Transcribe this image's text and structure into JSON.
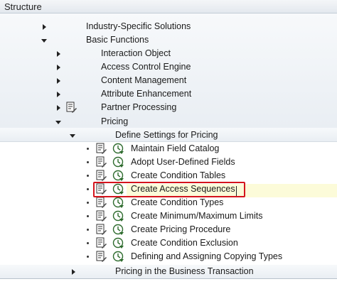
{
  "header": {
    "title": "Structure"
  },
  "tree": {
    "industry_specific": "Industry-Specific Solutions",
    "basic_functions": "Basic Functions",
    "interaction_object": "Interaction Object",
    "access_control_engine": "Access Control Engine",
    "content_management": "Content Management",
    "attribute_enhancement": "Attribute Enhancement",
    "partner_processing": "Partner Processing",
    "pricing": "Pricing",
    "define_settings": "Define Settings for Pricing",
    "activities": [
      "Maintain Field Catalog",
      "Adopt User-Defined Fields",
      "Create Condition Tables",
      "Create Access Sequences",
      "Create Condition Types",
      "Create Minimum/Maximum Limits",
      "Create Pricing Procedure",
      "Create Condition Exclusion",
      "Defining and Assigning Copying Types"
    ],
    "pricing_business_transaction": "Pricing in the Business Transaction"
  },
  "icons": {
    "documentation": "documentation-icon",
    "execute": "execute-clock-icon",
    "expand": "expand-arrow-icon",
    "collapse": "collapse-arrow-icon"
  },
  "colors": {
    "highlight_border": "#d4141d",
    "selected_background": "#fcfbd9",
    "band": "#e9eef3"
  }
}
